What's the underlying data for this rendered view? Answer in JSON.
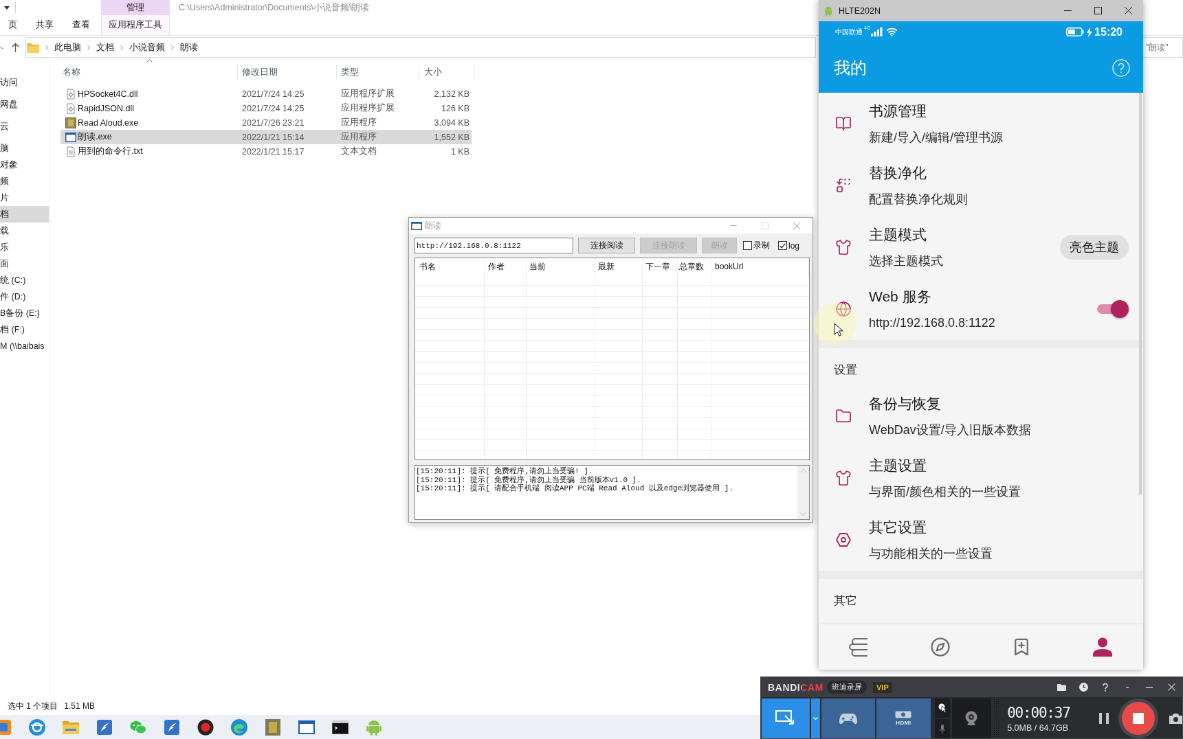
{
  "explorer": {
    "title": "C:\\Users\\Administrator\\Documents\\小说音频\\朗读",
    "context_group": "管理",
    "ribbon_tabs": [
      {
        "label": "页",
        "kind": "normal"
      },
      {
        "label": "共享",
        "kind": "normal"
      },
      {
        "label": "查看",
        "kind": "normal"
      },
      {
        "label": "应用程序工具",
        "kind": "contextual"
      }
    ],
    "breadcrumb": [
      "此电脑",
      "文档",
      "小说音频",
      "朗读"
    ],
    "search": {
      "placeholder": "\"朗读\""
    },
    "nav_items": [
      {
        "label": "访问",
        "kind": "group",
        "selected": false
      },
      {
        "label": "网盘",
        "kind": "group",
        "selected": false
      },
      {
        "label": "云",
        "kind": "group",
        "selected": false
      },
      {
        "label": "脑",
        "kind": "group",
        "selected": false
      },
      {
        "label": "对象",
        "kind": "child",
        "selected": false
      },
      {
        "label": "频",
        "kind": "child",
        "selected": false
      },
      {
        "label": "片",
        "kind": "child",
        "selected": false
      },
      {
        "label": "档",
        "kind": "child",
        "selected": true
      },
      {
        "label": "载",
        "kind": "child",
        "selected": false
      },
      {
        "label": "乐",
        "kind": "child",
        "selected": false
      },
      {
        "label": "面",
        "kind": "child",
        "selected": false
      },
      {
        "label": "统 (C:)",
        "kind": "child",
        "selected": false
      },
      {
        "label": "件 (D:)",
        "kind": "child",
        "selected": false
      },
      {
        "label": "B备份 (E:)",
        "kind": "child",
        "selected": false
      },
      {
        "label": "档 (F:)",
        "kind": "child",
        "selected": false
      },
      {
        "label": "M (\\\\baibais",
        "kind": "child",
        "selected": false
      }
    ],
    "columns": [
      "名称",
      "修改日期",
      "类型",
      "大小"
    ],
    "files": [
      {
        "name": "HPSocket4C.dll",
        "modified": "2021/7/24 14:25",
        "type": "应用程序扩展",
        "size": "2,132 KB",
        "kind": "library",
        "selected": false
      },
      {
        "name": "RapidJSON.dll",
        "modified": "2021/7/24 14:25",
        "type": "应用程序扩展",
        "size": "126 KB",
        "kind": "library",
        "selected": false
      },
      {
        "name": "Read Aloud.exe",
        "modified": "2021/7/26 23:21",
        "type": "应用程序",
        "size": "3,094 KB",
        "kind": "picture",
        "selected": false
      },
      {
        "name": "朗读.exe",
        "modified": "2022/1/21 15:14",
        "type": "应用程序",
        "size": "1,552 KB",
        "kind": "window",
        "selected": true
      },
      {
        "name": "用到的命令行.txt",
        "modified": "2022/1/21 15:17",
        "type": "文本文档",
        "size": "1 KB",
        "kind": "text",
        "selected": false
      }
    ],
    "status": {
      "selection": "选中 1 个项目",
      "size": "1.51 MB"
    }
  },
  "dialog": {
    "title": "朗读",
    "url": "http://192.168.0.8:1122",
    "buttons": [
      {
        "label": "连接阅读",
        "disabled": false
      },
      {
        "label": "连接朗读",
        "disabled": true
      },
      {
        "label": "朗读",
        "disabled": true
      }
    ],
    "checkboxes": [
      {
        "label": "录制",
        "checked": false
      },
      {
        "label": "log",
        "checked": true
      }
    ],
    "columns": [
      "书名",
      "作者",
      "当前",
      "最新",
      "下一章",
      "总章数",
      "bookUrl"
    ],
    "log": [
      "[15:20:11]: 提示[ 免费程序,请勿上当受骗! ].",
      "[15:20:11]: 提示[ 免费程序,请勿上当受骗 当前版本v1.0 ].",
      "[15:20:11]: 提示[ 请配合手机端 阅读APP PC端 Read Aloud 以及edge浏览器使用 ]."
    ]
  },
  "phone": {
    "window_title": "HLTE202N",
    "status_bar": {
      "carrier": "中国联通",
      "network": "4G",
      "time": "15:20"
    },
    "title": "我的",
    "sections": [
      {
        "items": [
          {
            "title": "书源管理",
            "subtitle": "新建/导入/编辑/管理书源",
            "kind": "plain"
          },
          {
            "title": "替换净化",
            "subtitle": "配置替换净化规则",
            "kind": "plain"
          },
          {
            "title": "主题模式",
            "subtitle": "选择主题模式",
            "kind": "chip",
            "chip": "亮色主题"
          },
          {
            "title": "Web 服务",
            "subtitle": "http://192.168.0.8:1122",
            "kind": "switch",
            "on": true
          }
        ]
      },
      {
        "header": "设置",
        "items": [
          {
            "title": "备份与恢复",
            "subtitle": "WebDav设置/导入旧版本数据",
            "kind": "plain"
          },
          {
            "title": "主题设置",
            "subtitle": "与界面/颜色相关的一些设置",
            "kind": "plain"
          },
          {
            "title": "其它设置",
            "subtitle": "与功能相关的一些设置",
            "kind": "plain"
          }
        ]
      },
      {
        "header": "其它"
      }
    ],
    "bottom_nav": [
      {
        "selected": false
      },
      {
        "selected": false
      },
      {
        "selected": false
      },
      {
        "selected": true
      }
    ]
  },
  "recorder": {
    "brand": "BANDICAM",
    "brand_sub": "班迪录屏",
    "badge": "VIP",
    "modes": [
      {
        "selected": true
      },
      {
        "selected": false
      },
      {
        "label": "HDMI",
        "selected": false
      }
    ],
    "elapsed": "00:00:37",
    "usage": "5.0MB / 64.7GB"
  }
}
